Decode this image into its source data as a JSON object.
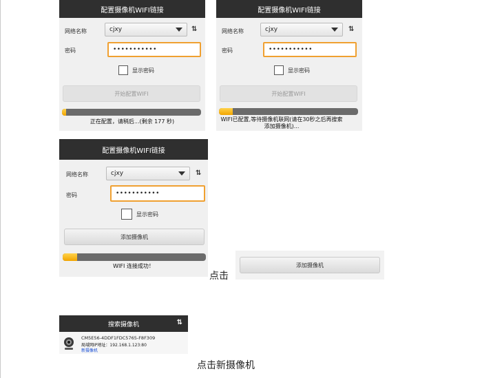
{
  "screens": [
    {
      "title": "配置摄像机WIFI链接",
      "network_label": "网络名称",
      "network_value": "cjxy",
      "password_label": "密码",
      "password_value": "•••••••••••",
      "show_password_label": "显示密码",
      "button_label": "开始配置WIFI",
      "progress_fraction": 0.03,
      "status": "正在配置，请稍后...(剩余 177 秒)"
    },
    {
      "title": "配置摄像机WIFI链接",
      "network_label": "网络名称",
      "network_value": "cjxy",
      "password_label": "密码",
      "password_value": "•••••••••••",
      "show_password_label": "显示密码",
      "button_label": "开始配置WIFI",
      "progress_fraction": 0.1,
      "status": "WIFI已配置,等待摄像机联网(请在30秒之后再搜索添加摄像机)..."
    },
    {
      "title": "配置摄像机WIFI链接",
      "network_label": "网络名称",
      "network_value": "cjxy",
      "password_label": "密码",
      "password_value": "•••••••••••",
      "show_password_label": "显示密码",
      "button_label": "添加摄像机",
      "progress_fraction": 0.1,
      "status": "WIFI 连接成功！"
    }
  ],
  "click_caption": "点击",
  "add_camera_button_label": "添加摄像机",
  "search": {
    "title": "搜索摄像机",
    "device_id": "CM5E56-4DDF1FDC5765-F8F309",
    "lan_ip": "局域网IP地址：192.168.1.123:80",
    "new_camera_label": "新摄像机",
    "new_camera_color": "#1a4fd6"
  },
  "click_new_camera_caption": "点击新摄像机",
  "colors": {
    "titlebar": "#2f2f2f",
    "focus_border": "#f0a030",
    "progress_fill": "#f2a500"
  },
  "icons": [
    "refresh-icon",
    "dropdown-arrow-icon",
    "checkbox-icon",
    "webcam-icon"
  ]
}
